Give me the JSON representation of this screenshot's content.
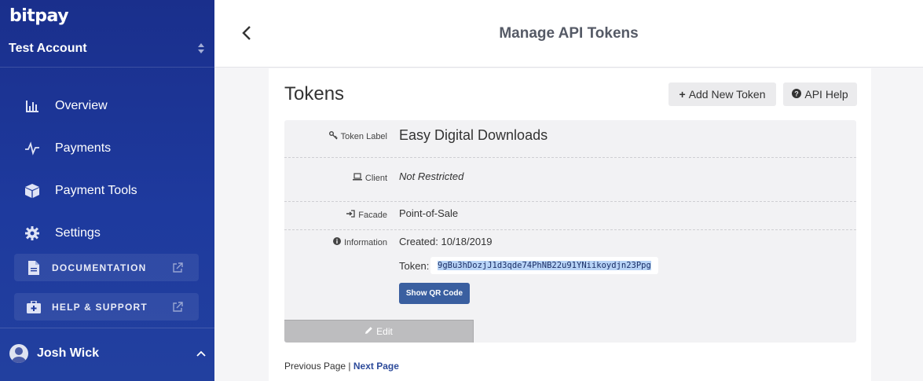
{
  "brand": {
    "logo": "bitpay"
  },
  "sidebar": {
    "account": "Test Account",
    "items": [
      {
        "label": "Overview",
        "icon": "bar-chart-icon"
      },
      {
        "label": "Payments",
        "icon": "pulse-icon"
      },
      {
        "label": "Payment Tools",
        "icon": "cube-icon"
      },
      {
        "label": "Settings",
        "icon": "gear-icon"
      }
    ],
    "links": [
      {
        "label": "DOCUMENTATION",
        "icon": "document-icon"
      },
      {
        "label": "HELP & SUPPORT",
        "icon": "first-aid-kit-icon"
      }
    ],
    "user": "Josh Wick"
  },
  "header": {
    "title": "Manage API Tokens"
  },
  "main": {
    "title": "Tokens",
    "add_button": "Add New Token",
    "help_button": "API Help",
    "token": {
      "label_caption": "Token Label",
      "label_value": "Easy Digital Downloads",
      "client_caption": "Client",
      "client_value": "Not Restricted",
      "facade_caption": "Facade",
      "facade_value": "Point-of-Sale",
      "info_caption": "Information",
      "created": "Created: 10/18/2019",
      "token_caption": "Token:",
      "token_value": "9gBu3hDozjJ1d3qde74PhNB22u91YNiikoydjn23Ppg",
      "qr_button": "Show QR Code",
      "edit_button": "Edit"
    },
    "pager": {
      "prev": "Previous Page",
      "separator": "|",
      "next": "Next Page"
    }
  },
  "colors": {
    "sidebar": "#1e3a9e",
    "primary_button": "#3a5fa0",
    "link": "#2c4a9a"
  }
}
